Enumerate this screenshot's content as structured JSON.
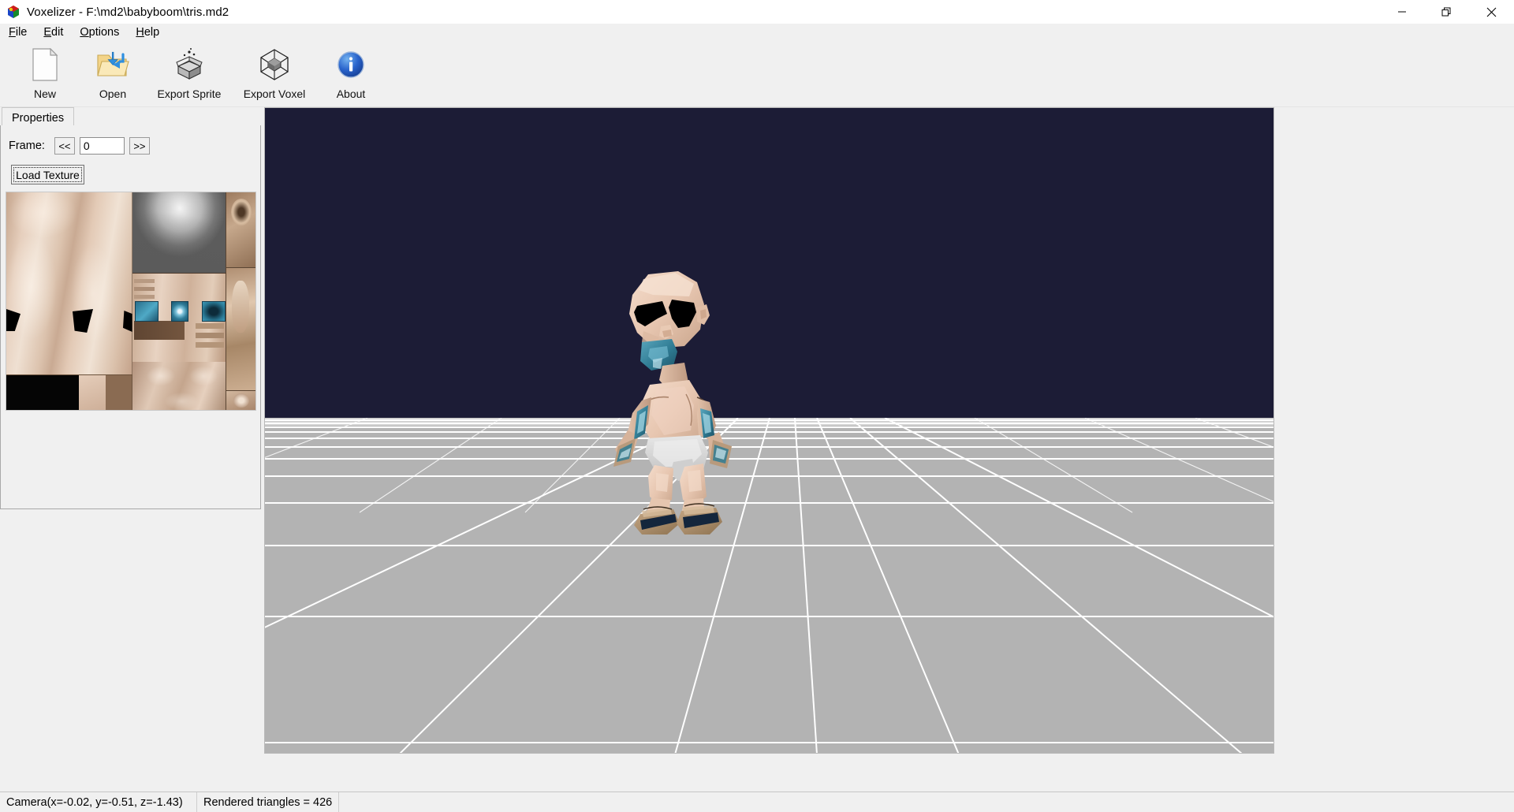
{
  "window": {
    "title": "Voxelizer - F:\\md2\\babyboom\\tris.md2",
    "app_icon": "voxel-cube-icon",
    "controls": {
      "minimize": "minimize-icon",
      "maximize": "restore-icon",
      "close": "close-icon"
    }
  },
  "menubar": {
    "items": [
      {
        "label": "File",
        "accel": "F"
      },
      {
        "label": "Edit",
        "accel": "E"
      },
      {
        "label": "Options",
        "accel": "O"
      },
      {
        "label": "Help",
        "accel": "H"
      }
    ]
  },
  "toolbar": {
    "buttons": [
      {
        "label": "New",
        "icon": "new-document-icon"
      },
      {
        "label": "Open",
        "icon": "open-folder-icon"
      },
      {
        "label": "Export Sprite",
        "icon": "export-sprite-box-icon"
      },
      {
        "label": "Export Voxel",
        "icon": "export-voxel-cube-icon"
      },
      {
        "label": "About",
        "icon": "info-circle-icon"
      }
    ]
  },
  "panel": {
    "tab": "Properties",
    "frame": {
      "label": "Frame:",
      "prev_label": "<<",
      "next_label": ">>",
      "value": "0",
      "placeholder": ""
    },
    "load_texture_label": "Load Texture",
    "texture_preview": {
      "name": "md2-skin-texture",
      "description": "babyboom MD2 skin atlas"
    }
  },
  "viewport": {
    "name": "3d-model-viewport",
    "sky_color": "#1c1c36",
    "ground_color": "#b3b3b3",
    "grid_color": "#ffffff",
    "model_name": "babyboom-md2-model"
  },
  "statusbar": {
    "camera": "Camera(x=-0.02, y=-0.51, z=-1.43)",
    "triangles": "Rendered triangles = 426"
  },
  "colors": {
    "skin": "#e8c6b0",
    "skin_light": "#f2d8c8",
    "skin_shadow": "#c8a28a",
    "diaper": "#d8d8d8",
    "pacifier": "#3d7f94",
    "blade": "#2f7d92",
    "eyebrow": "#000000",
    "sandal": "#b09070",
    "accent_blue": "#1a5fc8"
  }
}
